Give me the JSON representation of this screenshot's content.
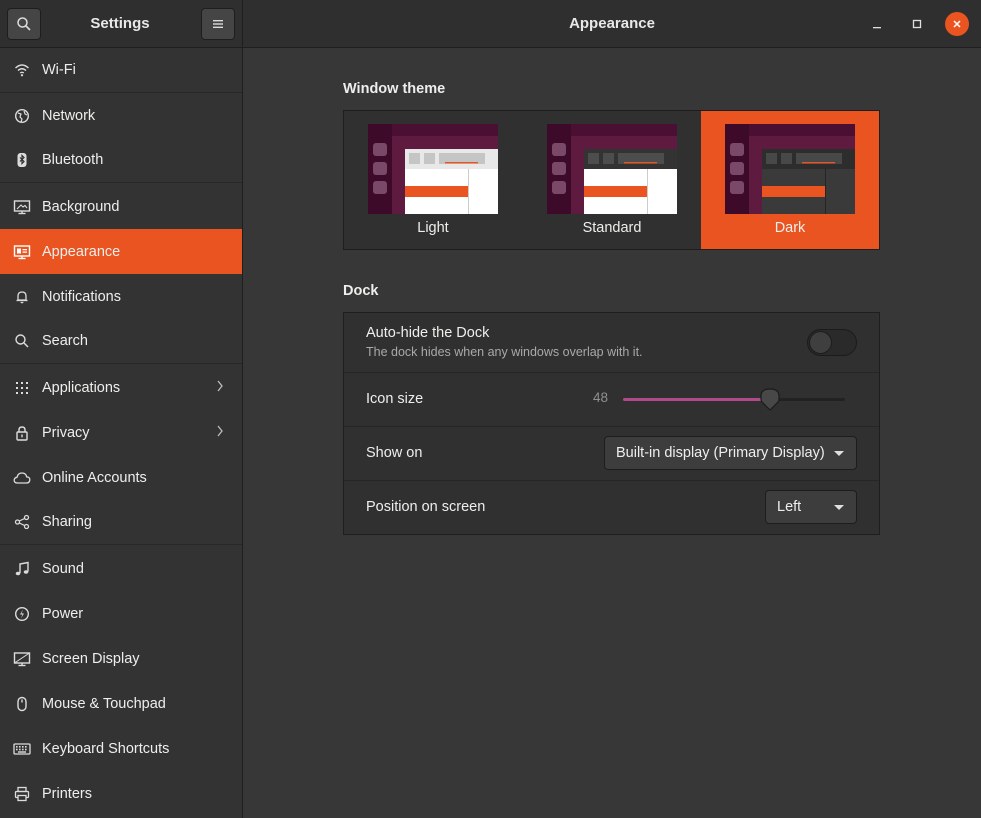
{
  "header": {
    "sidebar_title": "Settings",
    "page_title": "Appearance",
    "search_icon": "search-icon",
    "menu_icon": "hamburger-menu-icon"
  },
  "sidebar": {
    "active_index": 4,
    "accent": "#e95420",
    "items": [
      {
        "label": "Wi-Fi",
        "icon": "wifi-icon"
      },
      {
        "label": "Network",
        "icon": "globe-icon"
      },
      {
        "label": "Bluetooth",
        "icon": "bluetooth-icon"
      },
      {
        "label": "Background",
        "icon": "monitor-icon"
      },
      {
        "label": "Appearance",
        "icon": "appearance-icon"
      },
      {
        "label": "Notifications",
        "icon": "bell-icon"
      },
      {
        "label": "Search",
        "icon": "search-icon"
      },
      {
        "label": "Applications",
        "icon": "apps-grid-icon",
        "chevron": true
      },
      {
        "label": "Privacy",
        "icon": "lock-icon",
        "chevron": true
      },
      {
        "label": "Online Accounts",
        "icon": "cloud-icon"
      },
      {
        "label": "Sharing",
        "icon": "share-icon"
      },
      {
        "label": "Sound",
        "icon": "music-note-icon"
      },
      {
        "label": "Power",
        "icon": "power-icon"
      },
      {
        "label": "Screen Display",
        "icon": "display-icon"
      },
      {
        "label": "Mouse & Touchpad",
        "icon": "mouse-icon"
      },
      {
        "label": "Keyboard Shortcuts",
        "icon": "keyboard-icon"
      },
      {
        "label": "Printers",
        "icon": "printer-icon"
      }
    ]
  },
  "window_theme": {
    "title": "Window theme",
    "options": [
      {
        "label": "Light",
        "selected": false
      },
      {
        "label": "Standard",
        "selected": false
      },
      {
        "label": "Dark",
        "selected": true
      }
    ]
  },
  "dock": {
    "title": "Dock",
    "autohide": {
      "label": "Auto-hide the Dock",
      "description": "The dock hides when any windows overlap with it.",
      "enabled": false
    },
    "icon_size": {
      "label": "Icon size",
      "value": "48",
      "fraction": 0.66
    },
    "show_on": {
      "label": "Show on",
      "value": "Built-in display (Primary Display)"
    },
    "position": {
      "label": "Position on screen",
      "value": "Left"
    }
  }
}
